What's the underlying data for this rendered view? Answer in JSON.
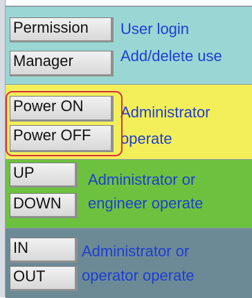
{
  "groups": [
    {
      "buttons": [
        "Permission",
        "Manager"
      ],
      "description_lines": [
        "User login",
        "Add/delete use"
      ]
    },
    {
      "buttons": [
        "Power ON",
        "Power OFF"
      ],
      "description_lines": [
        "Administrator",
        "operate"
      ]
    },
    {
      "buttons": [
        "UP",
        "DOWN"
      ],
      "description_lines": [
        "Administrator or",
        "engineer operate"
      ]
    },
    {
      "buttons": [
        "IN",
        "OUT"
      ],
      "description_lines": [
        "Administrator or",
        "operator operate"
      ]
    }
  ],
  "colors": {
    "group1_bg": "#9ad7d4",
    "group2_bg": "#f3ef5a",
    "group3_bg": "#6cc23f",
    "group4_bg": "#6b8a96",
    "description_text": "#1f3ed0",
    "highlight_border": "#d9303a"
  }
}
